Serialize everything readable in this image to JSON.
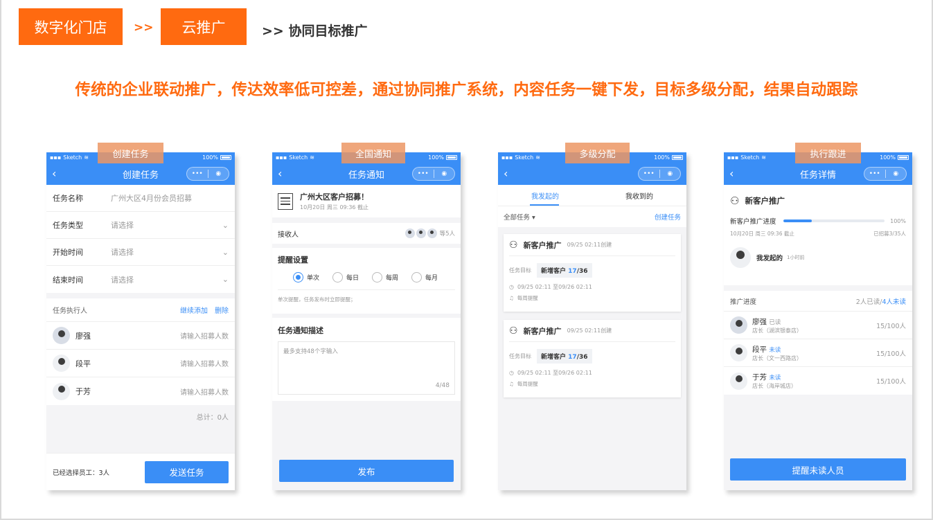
{
  "breadcrumb": {
    "item1": "数字化门店",
    "sep1": ">>",
    "item2": "云推广",
    "current": ">> 协同目标推广"
  },
  "headline": "传统的企业联动推广，传达效率低可控差，通过协同推广系统，内容任务一键下发，目标多级分配，结果自动跟踪",
  "accent_color": "#ff6a10",
  "app_color": "#3a8ef6",
  "status": {
    "carrier": "Sketch",
    "battery": "100%"
  },
  "capsule": {
    "more": "•••",
    "close": "◉"
  },
  "phone1": {
    "tag": "创建任务",
    "title": "创建任务",
    "fields": [
      {
        "label": "任务名称",
        "value": "广州大区4月份会员招募"
      },
      {
        "label": "任务类型",
        "value": "请选择"
      },
      {
        "label": "开始时间",
        "value": "请选择"
      },
      {
        "label": "结束时间",
        "value": "请选择"
      }
    ],
    "executors_label": "任务执行人",
    "add_label": "继续添加",
    "delete_label": "删除",
    "people": [
      {
        "name": "廖强",
        "hint": "请输入招募人数"
      },
      {
        "name": "段平",
        "hint": "请输入招募人数"
      },
      {
        "name": "于芳",
        "hint": "请输入招募人数"
      }
    ],
    "total": "总计：0人",
    "selected": "已经选择员工：3人",
    "send": "发送任务"
  },
  "phone2": {
    "tag": "全国通知",
    "title": "任务通知",
    "notice_title": "广州大区客户招募！",
    "notice_time": "10月20日 周三 09:36 截止",
    "receiver_label": "接收人",
    "receiver_count": "等5人",
    "remind_title": "提醒设置",
    "remind_options": [
      "单次",
      "每日",
      "每周",
      "每月"
    ],
    "remind_hint": "单次提醒，任务发布时立即提醒；",
    "desc_title": "任务通知描述",
    "desc_placeholder": "最多支持48个字输入",
    "desc_count": "4/48",
    "publish": "发布"
  },
  "phone3": {
    "tag": "多级分配",
    "tabs": [
      "我发起的",
      "我收到的"
    ],
    "filter": "全部任务",
    "create": "创建任务",
    "cards": [
      {
        "title": "新客户推广",
        "created": "09/25 02:11创建",
        "target_label": "任务目标",
        "target_name": "新增客户",
        "target_done": "17",
        "target_total": "/36",
        "period": "09/25 02:11 至09/26 02:11",
        "remind": "每周提醒"
      },
      {
        "title": "新客户推广",
        "created": "09/25 02:11创建",
        "target_label": "任务目标",
        "target_name": "新增客户",
        "target_done": "17",
        "target_total": "/36",
        "period": "09/25 02:11 至09/26 02:11",
        "remind": "每周提醒"
      }
    ]
  },
  "phone4": {
    "tag": "执行跟进",
    "title": "任务详情",
    "task_name": "新客户推广",
    "progress_label": "新客户推广进度",
    "progress_pct": "100%",
    "progress_fill": 0.28,
    "deadline": "10月20日 周三 09:36 截止",
    "recruited": "已招募3/35人",
    "creator": "我发起的",
    "creator_time": "1小时前",
    "track_label": "推广进度",
    "read_count": "2人已读/",
    "unread_count": "4人未读",
    "people": [
      {
        "name": "廖强",
        "state": "已读",
        "store": "店长（湖滨银泰店）",
        "progress": "15/100人"
      },
      {
        "name": "段平",
        "state": "未读",
        "store": "店长（文一西路店）",
        "progress": "15/100人"
      },
      {
        "name": "于芳",
        "state": "未读",
        "store": "店长（海岸城店）",
        "progress": "15/100人"
      }
    ],
    "remind_btn": "提醒未读人员"
  }
}
